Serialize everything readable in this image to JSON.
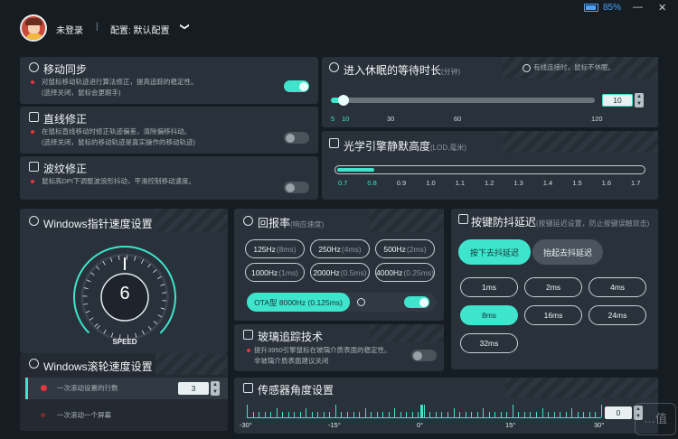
{
  "titlebar": {
    "battery": "85%",
    "minimize": "—",
    "close": "✕"
  },
  "header": {
    "user": "未登录",
    "sep": "|",
    "config": "配置: 默认配置",
    "chevron": "❯"
  },
  "motion_sync": {
    "title": "移动同步",
    "desc1": "对鼠标移动轨迹进行算法修正，提高追踪的稳定性。",
    "desc2": "(选择关闭，鼠标会更跟手)",
    "on": true
  },
  "straight": {
    "title": "直线修正",
    "desc1": "在鼠标直线移动时修正轨迹偏差，清除偏移抖动。",
    "desc2": "(选择关闭，鼠标的移动轨迹是真实操作的移动轨迹)",
    "on": false
  },
  "ripple": {
    "title": "波纹修正",
    "desc1": "鼠标高DPI下调整波浪形抖动，平滑控制移动速度。",
    "on": false
  },
  "sleep": {
    "title": "进入休眠的等待时长",
    "unit": "(分钟)",
    "note": "有线连接时，鼠标不休眠。",
    "value": "10",
    "ticks": [
      "5",
      "10",
      "30",
      "60",
      "120"
    ],
    "fraction": 0.04
  },
  "lod": {
    "title": "光学引擎静默高度",
    "unit": "(LOD,毫米)",
    "ticks": [
      "0.7",
      "0.8",
      "0.9",
      "1.0",
      "1.1",
      "1.2",
      "1.3",
      "1.4",
      "1.5",
      "1.6",
      "1.7"
    ],
    "value": 0.8
  },
  "pointer": {
    "title": "Windows指针速度设置",
    "value": "6",
    "label": "SPEED"
  },
  "scroll": {
    "title": "Windows滚轮速度设置",
    "opt1": "一次滚动设置的行数",
    "lines": "3",
    "opt2": "一次滚动一个屏幕"
  },
  "polling": {
    "title": "回报率",
    "unit": "(响应速度)",
    "options": [
      [
        "125Hz",
        "(8ms)"
      ],
      [
        "250Hz",
        "(4ms)"
      ],
      [
        "500Hz",
        "(2ms)"
      ],
      [
        "1000Hz",
        "(1ms)"
      ],
      [
        "2000Hz",
        "(0.5ms)"
      ],
      [
        "4000Hz",
        "(0.25ms)"
      ]
    ],
    "ota": "OTA型 8000Hz (0.125ms)",
    "ota_on": true
  },
  "debounce": {
    "title": "按键防抖延迟",
    "unit": "(按键延迟设置，防止按键误触双击)",
    "press": "按下去抖延迟",
    "release": "抬起去抖延迟",
    "options": [
      "1ms",
      "2ms",
      "4ms",
      "8ms",
      "16ms",
      "24ms",
      "32ms"
    ],
    "selected": "8ms"
  },
  "glass": {
    "title": "玻璃追踪技术",
    "desc1": "提升3950引擎鼠标在玻璃介质表面的稳定性。",
    "desc2": "非玻璃介质表面建议关闭",
    "on": false
  },
  "angle": {
    "title": "传感器角度设置",
    "ticks": [
      "-30°",
      "-15°",
      "0°",
      "15°",
      "30°"
    ],
    "value": "0"
  },
  "watermark": "…值",
  "colors": {
    "accent": "#3ee5cc",
    "panel": "#29313a",
    "bg": "#151c22",
    "dot": "#e0383e"
  }
}
